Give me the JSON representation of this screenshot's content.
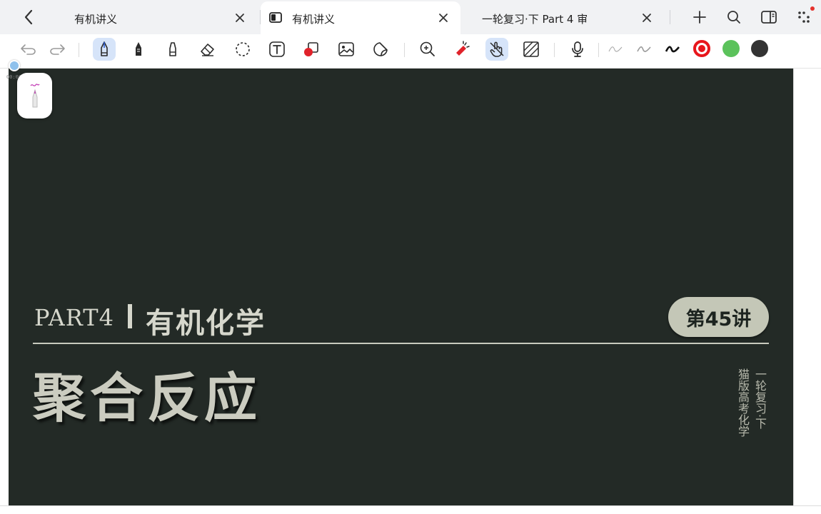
{
  "tabs": [
    {
      "label": "有机讲义",
      "active": false,
      "icon": ""
    },
    {
      "label": "有机讲义",
      "active": true,
      "icon": "split-view-icon"
    },
    {
      "label": "一轮复习·下 Part 4 审",
      "active": false,
      "icon": ""
    }
  ],
  "toolbar": {
    "tools": [
      "undo",
      "redo",
      "fountain-pen",
      "pencil",
      "highlighter",
      "eraser",
      "lasso",
      "text",
      "shapes",
      "image",
      "sticker",
      "zoom",
      "laser-pointer",
      "hand-touch",
      "ruler",
      "microphone"
    ],
    "active_tools": [
      "fountain-pen",
      "hand-touch"
    ],
    "pen_strokes": [
      "thin",
      "medium",
      "thick"
    ],
    "colors": [
      "#e8161c",
      "#5bc25b",
      "#333333"
    ]
  },
  "overlay": {
    "timer": "00:00"
  },
  "slide": {
    "part_label": "PART4",
    "section_title": "有机化学",
    "lecture_badge": "第45讲",
    "main_title": "聚合反应",
    "vertical_series": "一轮复习·下",
    "vertical_brand": "猫版高考化学",
    "background": "#232a26"
  }
}
